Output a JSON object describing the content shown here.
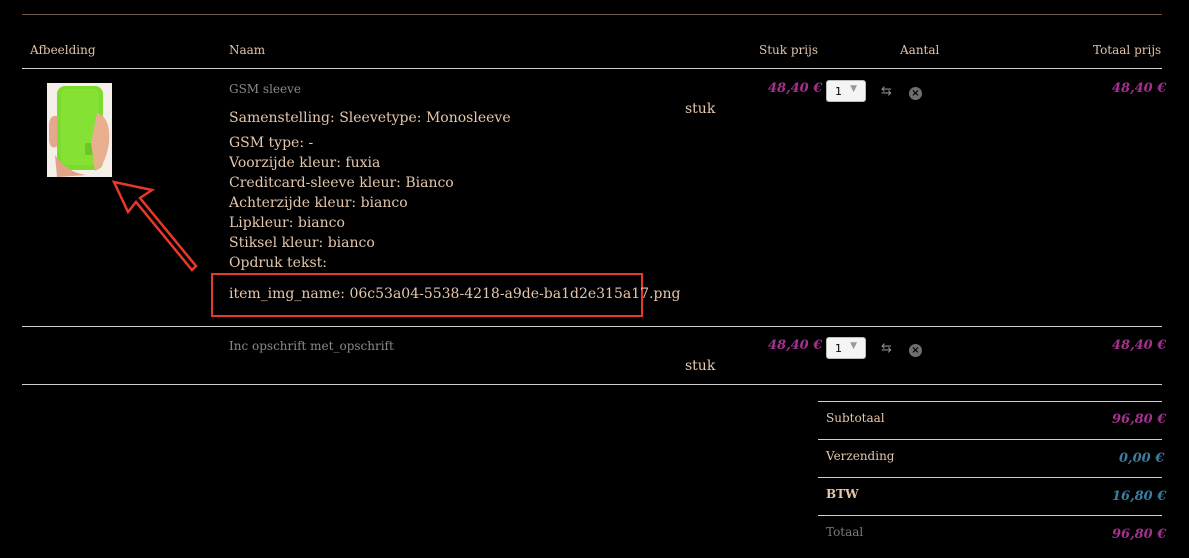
{
  "headers": {
    "image": "Afbeelding",
    "name": "Naam",
    "unit_price": "Stuk prijs",
    "quantity": "Aantal",
    "total_price": "Totaal prijs"
  },
  "items": [
    {
      "title": "GSM sleeve",
      "unit": "stuk",
      "unit_price": "48,40 €",
      "quantity": "1",
      "total": "48,40 €",
      "composition": "Samenstelling: Sleevetype: Monosleeve",
      "attributes": [
        "GSM type: -",
        "Voorzijde kleur: fuxia",
        "Creditcard-sleeve kleur: Bianco",
        "Achterzijde kleur: bianco",
        "Lipkleur: bianco",
        "Stiksel kleur: bianco",
        "Opdruk tekst:"
      ],
      "img_name": "item_img_name: 06c53a04-5538-4218-a9de-ba1d2e315a17.png"
    },
    {
      "title": "Inc opschrift met_opschrift",
      "unit": "stuk",
      "unit_price": "48,40 €",
      "quantity": "1",
      "total": "48,40 €"
    }
  ],
  "summary": {
    "subtotal_label": "Subtotaal",
    "subtotal": "96,80 €",
    "shipping_label": "Verzending",
    "shipping": "0,00 €",
    "vat_label": "BTW",
    "vat": "16,80 €",
    "total_label": "Totaal",
    "total": "96,80 €"
  },
  "colors": {
    "price": "#a4318f",
    "price_alt": "#3a7fa2",
    "annotation": "#e8382a",
    "product": "#7ddb2e"
  },
  "icons": [
    "refresh-icon",
    "remove-icon",
    "chevron-down-icon"
  ]
}
